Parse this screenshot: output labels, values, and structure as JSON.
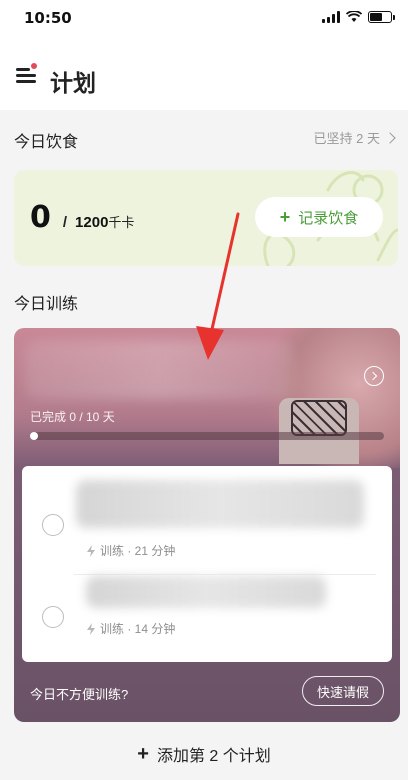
{
  "status_bar": {
    "time": "10:50"
  },
  "header": {
    "title": "计划"
  },
  "diet": {
    "section_title": "今日饮食",
    "streak": "已坚持 2 天",
    "current": "0",
    "slash": "/",
    "goal": "1200",
    "unit": "千卡",
    "log_button": "记录饮食",
    "log_plus": "+"
  },
  "training": {
    "section_title": "今日训练",
    "progress_text": "已完成 0 / 10 天",
    "progress_fraction": 0.0,
    "workouts": [
      {
        "meta": "训练 · 21 分钟"
      },
      {
        "meta": "训练 · 14 分钟"
      }
    ],
    "not_convenient": "今日不方便训练?",
    "leave_button": "快速请假"
  },
  "add_plan": {
    "plus": "+",
    "label": "添加第 2 个计划"
  },
  "colors": {
    "accent_green": "#4a9e38",
    "diet_card_bg": "#eef3de",
    "training_card_top": "#c98896",
    "training_card_bottom": "#6a5266",
    "annotation_red": "#e8322e",
    "menu_dot": "#e24b56"
  },
  "icons": [
    "menu-icon",
    "chevron-right-icon",
    "plus-icon",
    "bolt-icon",
    "radio-circle-icon",
    "signal-icon",
    "wifi-icon",
    "battery-icon",
    "annotation-arrow"
  ]
}
